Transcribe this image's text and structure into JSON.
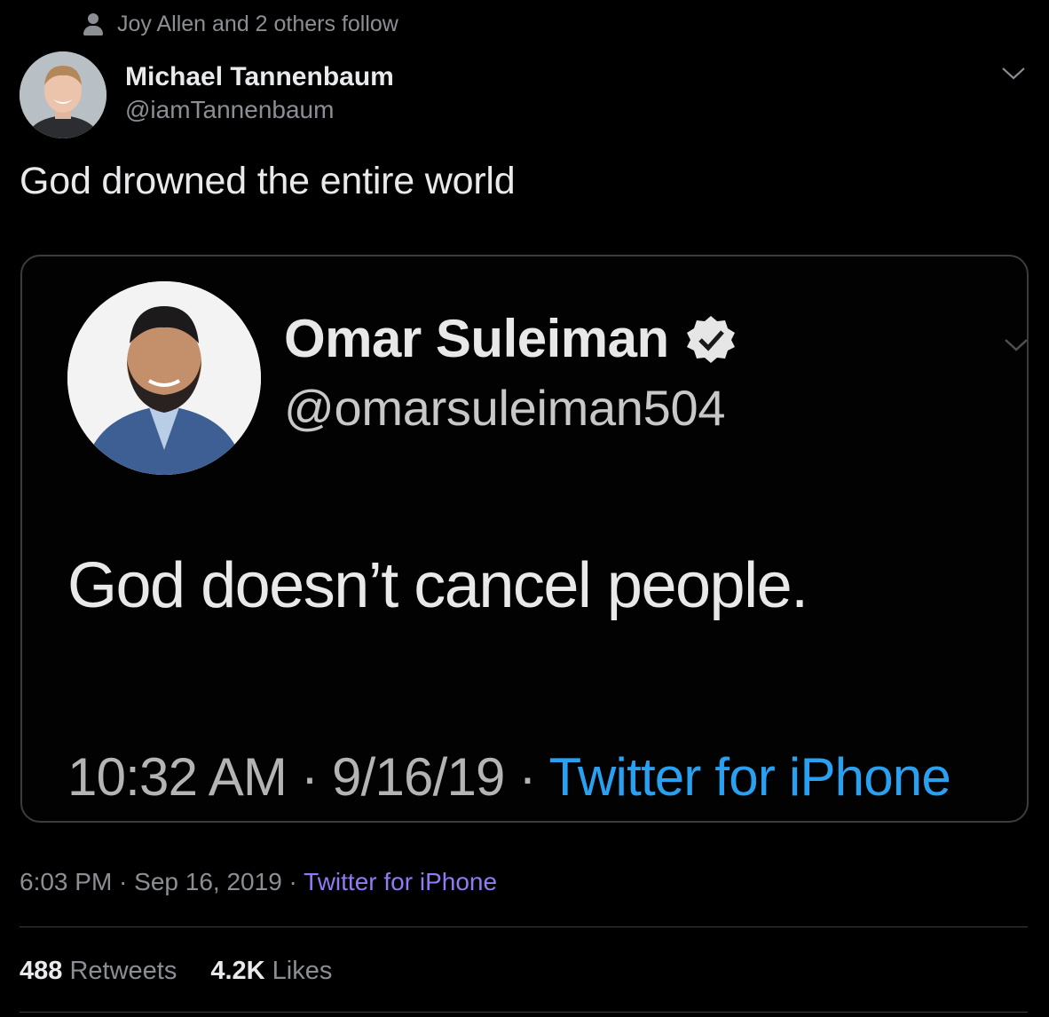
{
  "social_context": {
    "icon": "person-icon",
    "text": "Joy Allen and 2 others follow"
  },
  "author": {
    "name": "Michael Tannenbaum",
    "handle": "@iamTannenbaum"
  },
  "tweet": {
    "text": "God drowned the entire world"
  },
  "embedded_screenshot": {
    "name": "Omar Suleiman",
    "verified": true,
    "handle": "@omarsuleiman504",
    "text": "God doesn’t cancel people.",
    "time": "10:32 AM",
    "date": "9/16/19",
    "separator": " · ",
    "source": "Twitter for iPhone"
  },
  "meta": {
    "time": "6:03 PM",
    "date": "Sep 16, 2019",
    "separator": " · ",
    "source": "Twitter for iPhone"
  },
  "stats": {
    "retweets_count": "488",
    "retweets_label": "Retweets",
    "likes_count": "4.2K",
    "likes_label": "Likes"
  },
  "colors": {
    "background": "#000000",
    "text_primary": "#e9eaeb",
    "text_secondary": "#8b8f94",
    "source_link": "#8f7cf5",
    "embedded_source_link": "#2aa1f0",
    "border": "#3a3d40"
  }
}
